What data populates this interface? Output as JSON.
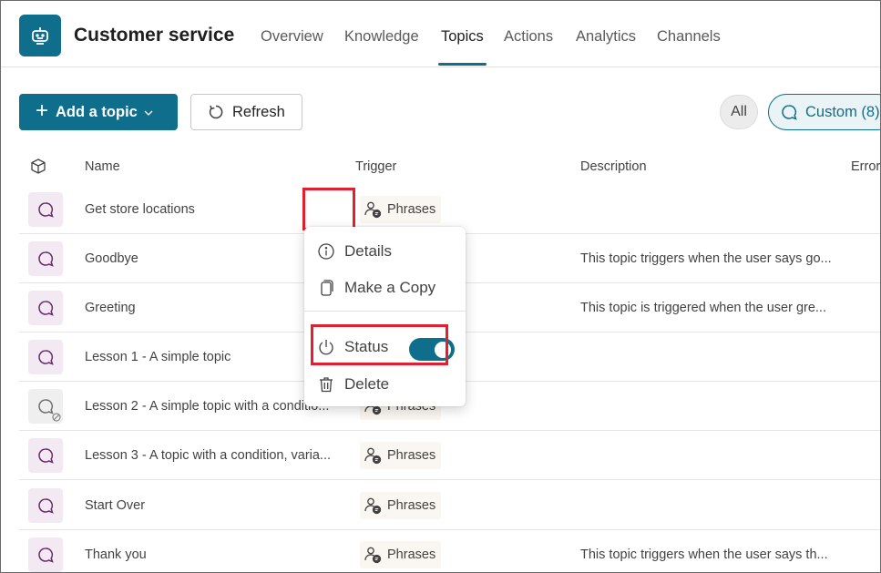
{
  "header": {
    "app_title": "Customer service",
    "tabs": [
      {
        "label": "Overview",
        "active": false
      },
      {
        "label": "Knowledge",
        "active": false
      },
      {
        "label": "Topics",
        "active": true
      },
      {
        "label": "Actions",
        "active": false
      },
      {
        "label": "Analytics",
        "active": false
      },
      {
        "label": "Channels",
        "active": false
      }
    ]
  },
  "toolbar": {
    "add_label": "Add a topic",
    "refresh_label": "Refresh",
    "filter_all": "All",
    "filter_custom": "Custom (8)"
  },
  "table": {
    "columns": {
      "name": "Name",
      "trigger": "Trigger",
      "description": "Description",
      "errors": "Errors"
    },
    "rows": [
      {
        "name": "Get store locations",
        "trigger": "Phrases",
        "description": "",
        "enabled": true
      },
      {
        "name": "Goodbye",
        "trigger": "",
        "description": "This topic triggers when the user says go...",
        "enabled": true
      },
      {
        "name": "Greeting",
        "trigger": "",
        "description": "This topic is triggered when the user gre...",
        "enabled": true
      },
      {
        "name": "Lesson 1 - A simple topic",
        "trigger": "",
        "description": "",
        "enabled": true
      },
      {
        "name": "Lesson 2 - A simple topic with a conditio...",
        "trigger": "Phrases",
        "description": "",
        "enabled": false
      },
      {
        "name": "Lesson 3 - A topic with a condition, varia...",
        "trigger": "Phrases",
        "description": "",
        "enabled": true
      },
      {
        "name": "Start Over",
        "trigger": "Phrases",
        "description": "",
        "enabled": true
      },
      {
        "name": "Thank you",
        "trigger": "Phrases",
        "description": "This topic triggers when the user says th...",
        "enabled": true
      }
    ]
  },
  "context_menu": {
    "details": "Details",
    "copy": "Make a Copy",
    "status": "Status",
    "status_on": true,
    "delete": "Delete"
  },
  "colors": {
    "accent": "#0f6e8c",
    "highlight": "#e0202e",
    "topic_icon": "#6b2b6b"
  }
}
